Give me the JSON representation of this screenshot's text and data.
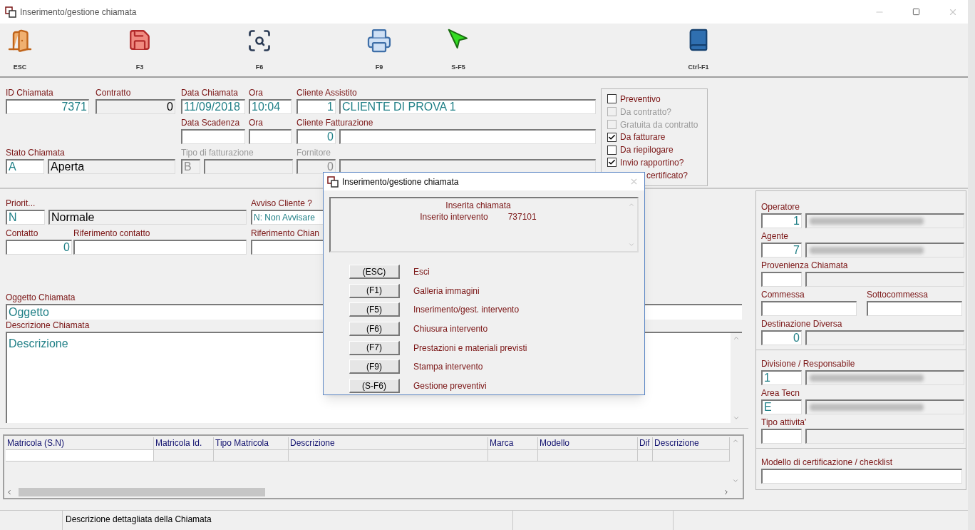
{
  "window": {
    "title": "Inserimento/gestione chiamata"
  },
  "toolbar": [
    {
      "kind": "exit",
      "label": "ESC"
    },
    {
      "kind": "save",
      "label": "F3"
    },
    {
      "kind": "search",
      "label": "F6"
    },
    {
      "kind": "print",
      "label": "F9"
    },
    {
      "kind": "send",
      "label": "S-F5"
    },
    {
      "kind": "help",
      "label": "Ctrl-F1"
    }
  ],
  "header": {
    "rows": [
      [
        {
          "label": "ID Chiamata",
          "disabled": false,
          "inputs": [
            {
              "kind": "number",
              "value": "7371",
              "editable": true
            }
          ]
        },
        {
          "label": "Contratto",
          "disabled": false,
          "inputs": [
            {
              "kind": "number",
              "value": "0",
              "editable": false
            }
          ]
        },
        {
          "label": "Data Chiamata",
          "disabled": false,
          "inputs": [
            {
              "kind": "text",
              "value": "11/09/2018",
              "editable": true
            }
          ]
        },
        {
          "label": "Ora",
          "disabled": false,
          "inputs": [
            {
              "kind": "text",
              "value": "10:04",
              "editable": true
            }
          ]
        },
        {
          "label": "Cliente Assistito",
          "disabled": false,
          "inputs": [
            {
              "kind": "number",
              "value": "1",
              "editable": true
            },
            {
              "kind": "text",
              "value": "CLIENTE DI PROVA 1",
              "editable": true
            }
          ]
        }
      ],
      [
        {
          "label": "Data Scadenza",
          "disabled": false,
          "inputs": [
            {
              "kind": "text",
              "editable": true
            }
          ]
        },
        {
          "label": "Ora",
          "disabled": false,
          "inputs": [
            {
              "kind": "text",
              "editable": true
            }
          ]
        },
        {
          "label": "Cliente Fatturazione",
          "disabled": false,
          "inputs": [
            {
              "kind": "number",
              "value": "0",
              "editable": true
            },
            {
              "kind": "text",
              "editable": true
            }
          ]
        }
      ],
      [
        {
          "label": "Stato Chiamata",
          "disabled": false,
          "inputs": [
            {
              "kind": "text",
              "value": "A",
              "editable": true
            },
            {
              "kind": "text",
              "value": "Aperta",
              "editable": false
            }
          ]
        },
        {
          "label": "Tipo di fatturazione",
          "disabled": true,
          "inputs": [
            {
              "kind": "text",
              "value": "B",
              "editable": false
            },
            {
              "kind": "text",
              "editable": false
            }
          ]
        },
        {
          "label": "Fornitore",
          "disabled": true,
          "inputs": [
            {
              "kind": "number",
              "value": "0",
              "editable": false
            },
            {
              "kind": "text",
              "editable": false
            }
          ]
        }
      ]
    ],
    "options": [
      {
        "label": "Preventivo",
        "checked": false,
        "disabled": false
      },
      {
        "label": "Da contratto?",
        "checked": false,
        "disabled": true
      },
      {
        "label": "Gratuita da contratto",
        "checked": false,
        "disabled": true
      },
      {
        "label": "Da fatturare",
        "checked": true,
        "disabled": false
      },
      {
        "label": "Da riepilogare",
        "checked": false,
        "disabled": false
      },
      {
        "label": "Invio rapportino?",
        "checked": true,
        "disabled": false
      },
      {
        "label": "certificato?",
        "disabled": false
      }
    ]
  },
  "details": {
    "priority": {
      "label": "Priorit...",
      "disabled": false,
      "inputs": [
        {
          "kind": "text",
          "value": "N",
          "editable": true
        },
        {
          "kind": "text",
          "value": "Normale",
          "editable": false
        }
      ]
    },
    "notify": {
      "label": "Avviso Cliente ?",
      "disabled": false,
      "inputs": [
        {
          "kind": "combo",
          "value": "N: Non Avvisare",
          "editable": true
        }
      ]
    },
    "contact": {
      "label": "Contatto",
      "disabled": false,
      "inputs": [
        {
          "kind": "number",
          "value": "0",
          "editable": true
        }
      ]
    },
    "contact_ref": {
      "label": "Riferimento contatto",
      "disabled": false,
      "inputs": [
        {
          "kind": "text",
          "editable": true
        }
      ]
    },
    "call_ref": {
      "label": "Riferimento Chian",
      "disabled": false,
      "inputs": [
        {
          "kind": "text",
          "editable": true
        }
      ]
    },
    "subject": {
      "label": "Oggetto Chiamata",
      "value": "Oggetto"
    },
    "description": {
      "label": "Descrizione Chiamata",
      "value": "Descrizione"
    }
  },
  "serials_table": {
    "columns": [
      "Matricola (S.N)",
      "Matricola Id.",
      "Tipo Matricola",
      "Descrizione",
      "Marca",
      "Modello",
      "Dif",
      "Descrizione"
    ]
  },
  "side_panel": {
    "sections": [
      [
        [
          {
            "label": "Operatore",
            "disabled": false,
            "inputs": [
              {
                "kind": "number",
                "value": "1",
                "editable": true
              },
              {
                "kind": "text",
                "editable": false,
                "blurred": true
              }
            ]
          }
        ],
        [
          {
            "label": "Agente",
            "disabled": false,
            "inputs": [
              {
                "kind": "number",
                "value": "7",
                "editable": true
              },
              {
                "kind": "text",
                "editable": false,
                "blurred": true
              }
            ]
          }
        ],
        [
          {
            "label": "Provenienza Chiamata",
            "disabled": false,
            "inputs": [
              {
                "kind": "text",
                "editable": true
              },
              {
                "kind": "text",
                "editable": false
              }
            ]
          }
        ],
        [
          {
            "label": "Commessa",
            "disabled": false,
            "inputs": [
              {
                "kind": "text",
                "editable": true
              }
            ]
          },
          {
            "label": "Sottocommessa",
            "disabled": false,
            "inputs": [
              {
                "kind": "text",
                "editable": true
              }
            ]
          }
        ],
        [
          {
            "label": "Destinazione Diversa",
            "disabled": false,
            "inputs": [
              {
                "kind": "number",
                "value": "0",
                "editable": true
              },
              {
                "kind": "text",
                "editable": false
              }
            ]
          }
        ]
      ],
      [
        [
          {
            "label": "Divisione / Responsabile",
            "disabled": false,
            "inputs": [
              {
                "kind": "text",
                "value": "1",
                "editable": true
              },
              {
                "kind": "text",
                "editable": false,
                "blurred": true
              }
            ]
          }
        ],
        [
          {
            "label": "Area Tecn",
            "disabled": false,
            "inputs": [
              {
                "kind": "text",
                "value": "E",
                "editable": true
              },
              {
                "kind": "text",
                "editable": false,
                "blurred": true
              }
            ]
          }
        ],
        [
          {
            "label": "Tipo attivita'",
            "disabled": false,
            "inputs": [
              {
                "kind": "text",
                "editable": true
              },
              {
                "kind": "text",
                "editable": false
              }
            ]
          }
        ]
      ],
      [
        [
          {
            "label": "Modello di certificazione / checklist",
            "disabled": false,
            "inputs": [
              {
                "kind": "text",
                "editable": true
              }
            ]
          }
        ]
      ]
    ]
  },
  "dialog": {
    "title": "Inserimento/gestione chiamata",
    "messages": [
      {
        "text": "Inserita chiamata"
      },
      {
        "text": "Inserito intervento",
        "value": "737101"
      }
    ],
    "actions": [
      {
        "key": "(ESC)",
        "label": "Esci"
      },
      {
        "key": "(F1)",
        "label": "Galleria immagini"
      },
      {
        "key": "(F5)",
        "label": "Inserimento/gest. intervento"
      },
      {
        "key": "(F6)",
        "label": "Chiusura intervento"
      },
      {
        "key": "(F7)",
        "label": "Prestazioni e materiali previsti"
      },
      {
        "key": "(F9)",
        "label": "Stampa intervento"
      },
      {
        "key": "(S-F6)",
        "label": "Gestione preventivi"
      }
    ]
  },
  "status_bar": {
    "message": "Descrizione dettagliata della Chiamata"
  }
}
